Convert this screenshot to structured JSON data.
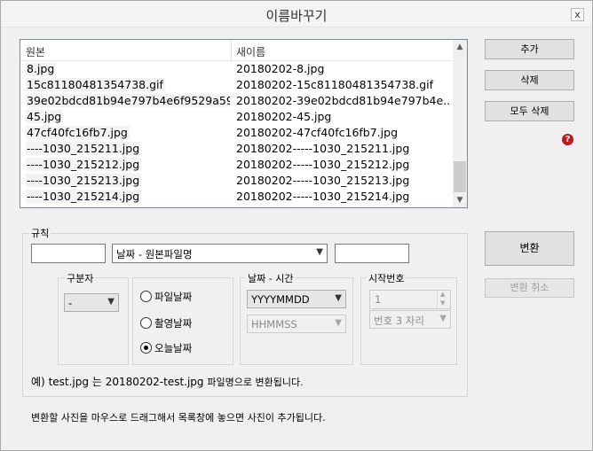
{
  "window": {
    "title": "이름바꾸기",
    "close_label": "x"
  },
  "file_list": {
    "columns": {
      "original": "원본",
      "new_name": "새이름"
    },
    "rows": [
      {
        "original": "8.jpg",
        "new_name": "20180202-8.jpg"
      },
      {
        "original": "15c81180481354738.gif",
        "new_name": "20180202-15c81180481354738.gif"
      },
      {
        "original": "39e02bdcd81b94e797b4e6f9529a597...",
        "new_name": "20180202-39e02bdcd81b94e797b4e..."
      },
      {
        "original": "45.jpg",
        "new_name": "20180202-45.jpg"
      },
      {
        "original": "47cf40fc16fb7.jpg",
        "new_name": "20180202-47cf40fc16fb7.jpg"
      },
      {
        "original": "----1030_215211.jpg",
        "new_name": "20180202-----1030_215211.jpg"
      },
      {
        "original": "----1030_215212.jpg",
        "new_name": "20180202-----1030_215212.jpg"
      },
      {
        "original": "----1030_215213.jpg",
        "new_name": "20180202-----1030_215213.jpg"
      },
      {
        "original": "----1030_215214.jpg",
        "new_name": "20180202-----1030_215214.jpg"
      }
    ],
    "scroll_up_icon": "chevron-up-icon",
    "scroll_down_icon": "chevron-down-icon"
  },
  "buttons": {
    "add": "추가",
    "delete": "삭제",
    "delete_all": "모두 삭제",
    "convert": "변환",
    "cancel_convert": "변환 취소"
  },
  "help_icon": {
    "glyph": "?",
    "color": "#c0181e"
  },
  "rules": {
    "label": "규칙",
    "prefix_value": "",
    "format_selected": "날짜 - 원본파일명",
    "suffix_value": "",
    "separator": {
      "label": "구분자",
      "selected": "-"
    },
    "date_source": {
      "options": [
        {
          "label": "파일날짜",
          "checked": false
        },
        {
          "label": "촬영날짜",
          "checked": false
        },
        {
          "label": "오늘날짜",
          "checked": true
        }
      ]
    },
    "date_time": {
      "label": "날짜 - 시간",
      "date_format": "YYYYMMDD",
      "time_format": "HHMMSS"
    },
    "start_number": {
      "label": "시작번호",
      "value": "1",
      "digits": "번호 3 자리"
    },
    "example": {
      "prefix": "예)",
      "source": "test.jpg",
      "connector": "는",
      "result": "20180202-test.jpg",
      "suffix": "파일명으로 변환됩니다."
    }
  },
  "hint": "변환할 사진을 마우스로 드래그해서 목록창에 놓으면 사진이 추가됩니다."
}
